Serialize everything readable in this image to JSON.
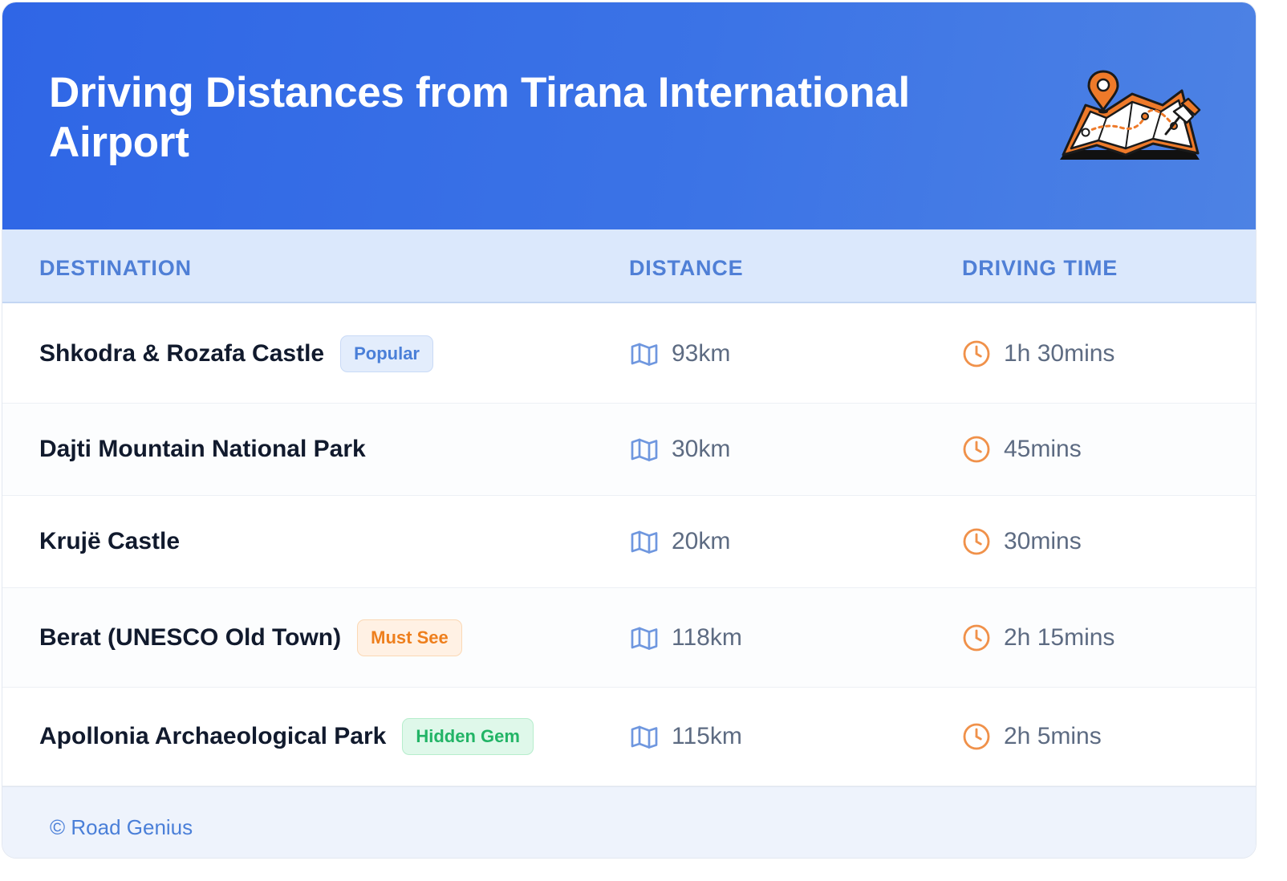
{
  "header": {
    "title": "Driving Distances from Tirana International Airport",
    "illustration_icon": "map-with-pins-icon",
    "gradient_start": "#2f66e6",
    "gradient_end": "#4d82e4"
  },
  "table": {
    "columns": [
      "DESTINATION",
      "DISTANCE",
      "DRIVING TIME"
    ],
    "distance_icon": "map-icon",
    "time_icon": "clock-icon",
    "rows": [
      {
        "destination": "Shkodra & Rozafa Castle",
        "badge": "Popular",
        "badge_color": "#4a7fd8",
        "distance": "93km",
        "time": "1h 30mins"
      },
      {
        "destination": "Dajti Mountain National Park",
        "badge": "",
        "distance": "30km",
        "time": "45mins"
      },
      {
        "destination": "Krujë Castle",
        "badge": "",
        "distance": "20km",
        "time": "30mins"
      },
      {
        "destination": "Berat (UNESCO Old Town)",
        "badge": "Must See",
        "badge_color": "#ee7f1d",
        "distance": "118km",
        "time": "2h 15mins"
      },
      {
        "destination": "Apollonia Archaeological Park",
        "badge": "Hidden Gem",
        "badge_color": "#22b466",
        "distance": "115km",
        "time": "2h 5mins"
      }
    ]
  },
  "footer": {
    "text": "© Road Genius"
  },
  "colors": {
    "accent": "#4a7fd8",
    "clock": "#f0914a",
    "header_row": "#dbe8fc"
  }
}
